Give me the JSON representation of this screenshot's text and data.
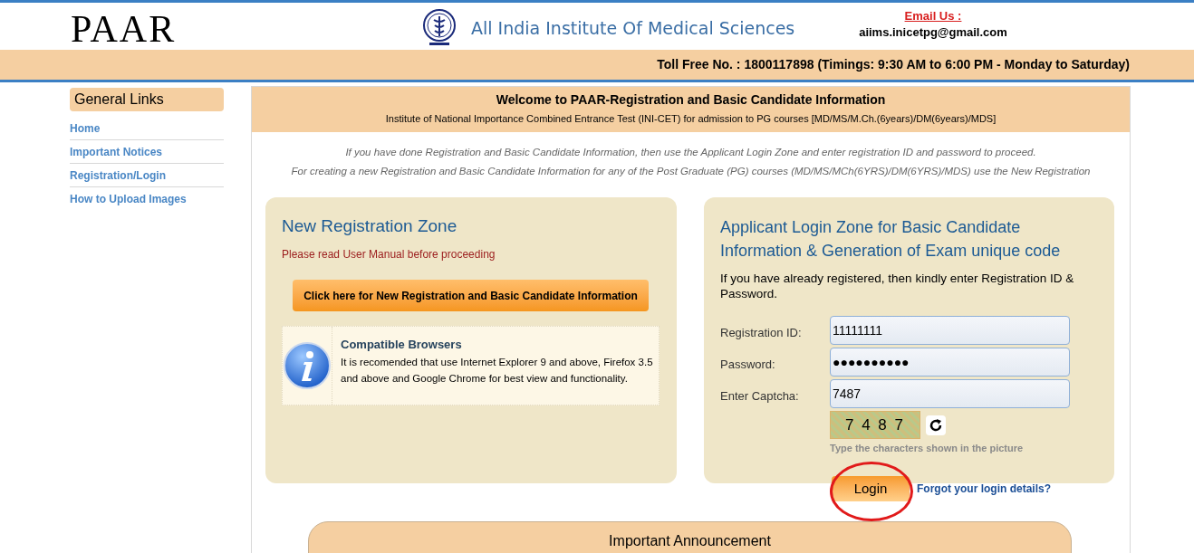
{
  "header": {
    "logo": "PAAR",
    "institute": "All India Institute Of Medical Sciences",
    "email_label": "Email Us :",
    "email": "aiims.inicetpg@gmail.com"
  },
  "toll_free": "Toll Free No. : 1800117898 (Timings: 9:30 AM to 6:00 PM - Monday to Saturday)",
  "sidebar": {
    "title": "General Links",
    "items": [
      {
        "label": "Home"
      },
      {
        "label": "Important Notices"
      },
      {
        "label": "Registration/Login"
      },
      {
        "label": "How to Upload Images"
      }
    ]
  },
  "welcome": {
    "title": "Welcome to PAAR-Registration and Basic Candidate Information",
    "subtitle": "Institute of National Importance Combined Entrance Test (INI-CET) for admission to PG courses [MD/MS/M.Ch.(6years)/DM(6years)/MDS]",
    "notes": [
      "If you have done Registration and Basic Candidate Information, then use the Applicant Login Zone and enter registration ID and password to proceed.",
      "For creating a new Registration and Basic Candidate Information for any of the Post Graduate (PG) courses (MD/MS/MCh(6YRS)/DM(6YRS)/MDS) use the New Registration"
    ]
  },
  "new_registration": {
    "title": "New Registration Zone",
    "warning": "Please read User Manual before proceeding",
    "button": "Click here for New Registration and Basic Candidate Information",
    "info_title": "Compatible Browsers",
    "info_text": "It is recomended that use Internet Explorer 9 and above, Firefox 3.5 and above and Google Chrome for best view and functionality."
  },
  "login": {
    "title": "Applicant Login Zone for Basic Candidate Information & Generation of Exam unique code",
    "intro": "If you have already registered, then kindly enter Registration ID & Password.",
    "fields": [
      {
        "label": "Registration ID:",
        "value": "11111111"
      },
      {
        "label": "Password:",
        "value": "●●●●●●●●●●"
      },
      {
        "label": "Enter Captcha:",
        "value": "7487"
      }
    ],
    "captcha": "7 4 8 7",
    "captcha_hint": "Type the characters shown in the picture",
    "button": "Login",
    "forgot": "Forgot your login details?"
  },
  "announcement": {
    "title": "Important Announcement"
  }
}
